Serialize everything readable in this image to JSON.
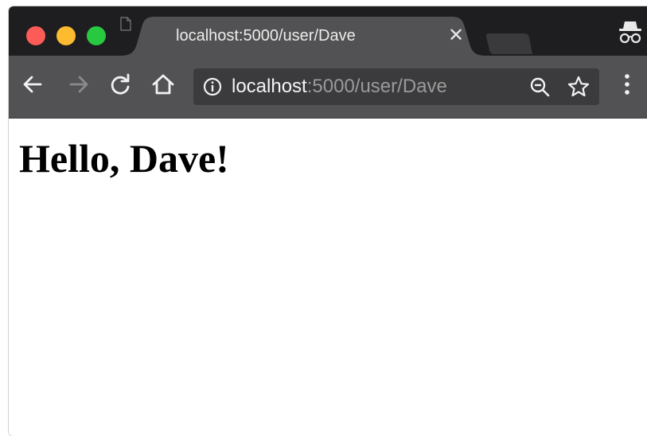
{
  "colors": {
    "close": "#fc5b57",
    "minimize": "#fdbb2f",
    "maximize": "#28c840",
    "tabstrip": "#1e1e20",
    "toolbar": "#525254",
    "active_tab": "#525254"
  },
  "tab": {
    "title": "localhost:5000/user/Dave",
    "close_glyph": "✕",
    "favicon": "page-icon"
  },
  "omnibox": {
    "host": "localhost",
    "path": ":5000/user/Dave",
    "info_icon": "info-icon",
    "zoom_icon": "zoom-out-icon",
    "star_icon": "star-icon"
  },
  "toolbar": {
    "back_icon": "back-arrow-icon",
    "forward_icon": "forward-arrow-icon",
    "reload_icon": "reload-icon",
    "home_icon": "home-icon",
    "menu_icon": "menu-dots-icon"
  },
  "profile": {
    "icon": "incognito-icon"
  },
  "page": {
    "heading": "Hello, Dave!"
  }
}
